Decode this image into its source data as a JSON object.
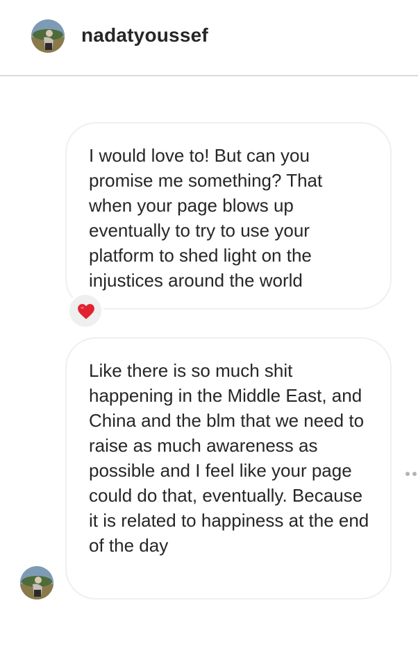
{
  "header": {
    "username": "nadatyoussef",
    "avatar_icon": "profile-photo-icon"
  },
  "messages": [
    {
      "text": "I would love to! But can you promise me something? That when your page blows up eventually to try to use your platform to shed light on the injustices around the world",
      "reaction": "red-heart-icon"
    },
    {
      "text": "Like there is so much shit happening in the Middle East, and China and the blm that we need to raise as much awareness as possible and I feel like your page could do that, eventually. Because it is related to happiness at the end of the day"
    }
  ],
  "colors": {
    "text": "#262626",
    "divider": "#dbdbdb",
    "bubble_border": "#efefef",
    "reaction_bg": "#efefef",
    "heart": "#e0232e"
  },
  "icons": {
    "more_options": "more-options-icon"
  }
}
